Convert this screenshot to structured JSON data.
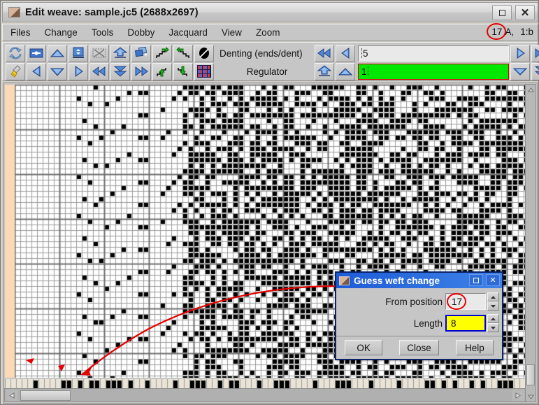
{
  "window": {
    "title": "Edit weave: sample.jc5 (2688x2697)",
    "icon": "weave-swatch-icon",
    "maximize_label": "maximize-icon",
    "close_label": "✕"
  },
  "menu": {
    "items": [
      {
        "label": "Files"
      },
      {
        "label": "Change"
      },
      {
        "label": "Tools"
      },
      {
        "label": "Dobby"
      },
      {
        "label": "Jacquard"
      },
      {
        "label": "View"
      },
      {
        "label": "Zoom"
      }
    ],
    "status": {
      "position": "17",
      "shaft": "A,",
      "ratio": "1:b"
    }
  },
  "toolbar": {
    "row1_icons": [
      "refresh-icon",
      "flip-horizontal-icon",
      "up-triangle-icon",
      "vertical-resize-icon",
      "clear-selection-icon",
      "double-up-icon",
      "copy-layer-icon",
      "stairs-right-icon",
      "stairs-left-icon",
      "invert-icon"
    ],
    "row2_icons": [
      "broom-icon",
      "left-triangle-icon",
      "down-triangle-icon",
      "right-triangle-icon",
      "double-left-icon",
      "double-down-icon",
      "double-right-icon",
      "stairs-up-icon",
      "stairs-down-icon",
      "weave-texture-icon"
    ],
    "denting": {
      "label": "Denting (ends/dent)",
      "value": "5",
      "prev_all_icon": "double-left-icon",
      "prev_icon": "left-triangle-icon",
      "next_icon": "right-triangle-icon",
      "next_all_icon": "double-right-icon"
    },
    "regulator": {
      "label": "Regulator",
      "value": "1",
      "up_all_icon": "double-up-icon",
      "up_icon": "up-triangle-icon",
      "down_icon": "down-triangle-icon",
      "down_all_icon": "double-down-icon"
    }
  },
  "dialog": {
    "title": "Guess weft change",
    "icon": "weave-swatch-icon",
    "maximize_label": "maximize-icon",
    "close_label": "✕",
    "from_position": {
      "label": "From position",
      "value": "17"
    },
    "length": {
      "label": "Length",
      "value": "8"
    },
    "buttons": {
      "ok": "OK",
      "close": "Close",
      "help": "Help"
    }
  },
  "colors": {
    "accent": "#0a246a",
    "annotation": "#e60000",
    "regulator_field": "#00e800",
    "length_field": "#ffff00",
    "warp_strip": "#fbd9b6",
    "grid_line": "#808080"
  },
  "grid": {
    "cell_size": 8,
    "heavy_interval": 8,
    "columns": 92,
    "rows": 52
  },
  "scrollbars": {
    "horizontal_thumb_label": "horizontal-scroll-thumb",
    "vertical_thumb_label": "vertical-scroll-thumb"
  }
}
